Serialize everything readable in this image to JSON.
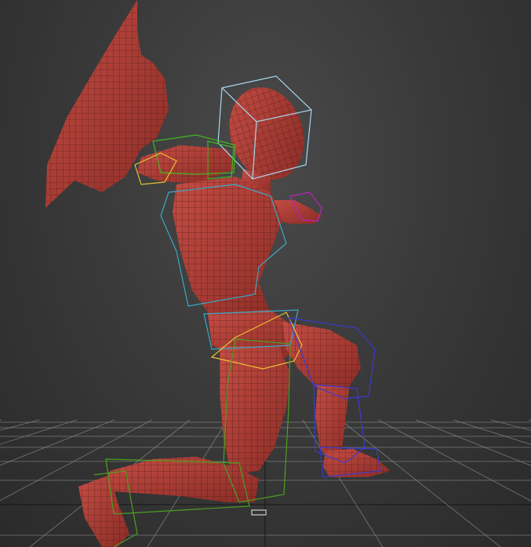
{
  "viewport": {
    "background_top": "#4a4a4a",
    "background_bottom": "#2a2a2a",
    "grid_color": "#8a8a8a",
    "grid_major_color": "#1a1a1a"
  },
  "model": {
    "skin_color": "#b8413a",
    "skin_shadow": "#7a2420",
    "wire_color": "#2a0c0a"
  },
  "rig_colors": {
    "head_box": "#a8d8f0",
    "spine": "#3aa8c8",
    "left_leg": "#4aa020",
    "right_leg": "#3a3ad0",
    "pelvis": "#e8c030",
    "right_hand": "#c020c0",
    "left_hand": "#e8c030",
    "arm": "#40b820"
  }
}
